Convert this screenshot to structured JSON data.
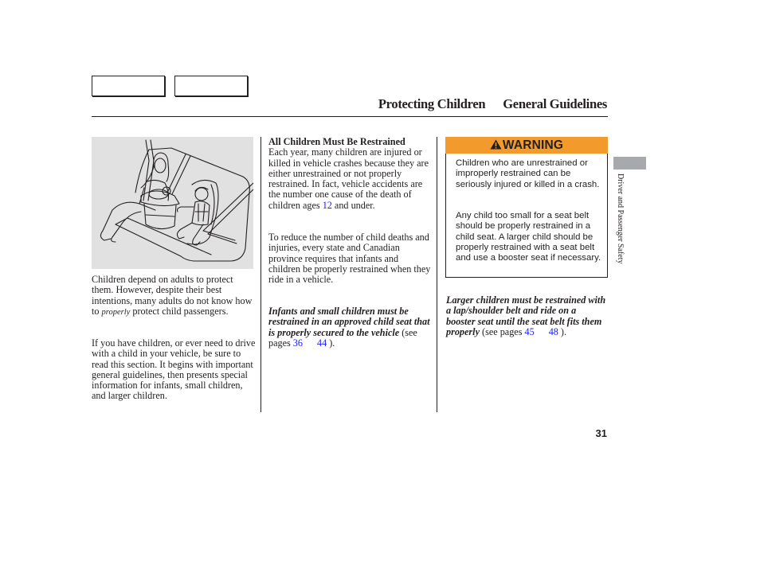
{
  "nav": {
    "box1_label": "",
    "box2_label": ""
  },
  "header": {
    "section": "Protecting Children",
    "subsection": "General Guidelines"
  },
  "illustration": {
    "icon": "child-seat-illustration",
    "description": "Adult seated in rear seat with infant in carrier and child in forward-facing child seat"
  },
  "col1": {
    "para1_a": "Children depend on adults to protect them. However, despite their best intentions, many adults do not know how to ",
    "para1_em": "properly",
    "para1_b": " protect child passengers.",
    "para2": "If you have children, or ever need to drive with a child in your vehicle, be sure to read this section. It begins with important general guidelines, then presents special information for infants, small children, and larger children."
  },
  "col2": {
    "heading": "All Children Must Be Restrained",
    "para1_a": "Each year, many children are injured or killed in vehicle crashes because they are either unrestrained or not properly restrained. In fact, vehicle accidents are the number one cause of the death of children ages ",
    "para1_link": "12",
    "para1_b": " and under.",
    "para2": "To reduce the number of child deaths and injuries, every state and Canadian province requires that infants and children be properly restrained when they ride in a vehicle.",
    "para3_bold": "Infants and small children must be restrained in an approved child seat that is properly secured to the vehicle",
    "para3_pre": " (see pages ",
    "para3_link1": "36",
    "para3_link2": "44",
    "para3_post": " )."
  },
  "warning": {
    "icon": "warning-triangle-icon",
    "title": "WARNING",
    "para1": "Children who are unrestrained or improperly restrained can be seriously injured or killed in a crash.",
    "para2": "Any child too small for a seat belt should be properly restrained in a child seat. A larger child should be properly restrained with a seat belt and use a booster seat if necessary.",
    "header_color": "#f39a2d"
  },
  "col3": {
    "para_bold": "Larger children must be restrained with a lap/shoulder belt and ride on a booster seat until the seat belt fits them properly",
    "para_pre": " (see pages ",
    "para_link1": "45",
    "para_link2": "48",
    "para_post": " )."
  },
  "side": {
    "label": "Driver and Passenger Safety",
    "tab_color": "#a7a9ac"
  },
  "footer": {
    "page_number": "31"
  },
  "colors": {
    "link": "#1a1aff",
    "text": "#231f20"
  }
}
